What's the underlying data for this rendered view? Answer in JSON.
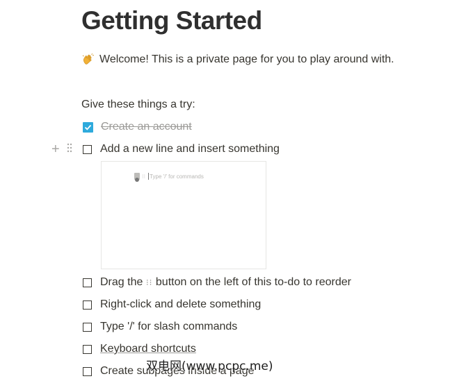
{
  "page": {
    "title": "Getting Started",
    "welcome_text": "Welcome! This is a private page for you to play around with.",
    "intro_text": "Give these things a try:"
  },
  "todos": [
    {
      "label": "Create an account",
      "checked": true
    },
    {
      "label": "Add a new line and insert something",
      "checked": false
    },
    {
      "label_before": "Drag the ",
      "label_grip": "⁝⁝",
      "label_after": " button on the left of this to-do to reorder",
      "checked": false
    },
    {
      "label": "Right-click and delete something",
      "checked": false
    },
    {
      "label": "Type '/' for slash commands",
      "checked": false
    },
    {
      "label": "Keyboard shortcuts",
      "checked": false
    },
    {
      "label": "Create subpages inside a page",
      "checked": false
    }
  ],
  "media": {
    "placeholder_text": "Type '/' for commands"
  },
  "watermark": "双电网(www.pcpc.me)",
  "colors": {
    "checkbox_checked": "#2eaadc",
    "text": "#37352f",
    "muted": "#9b9a97"
  },
  "icons": [
    "wave-hand-icon",
    "plus-icon",
    "drag-handle-icon",
    "checkmark-icon"
  ]
}
